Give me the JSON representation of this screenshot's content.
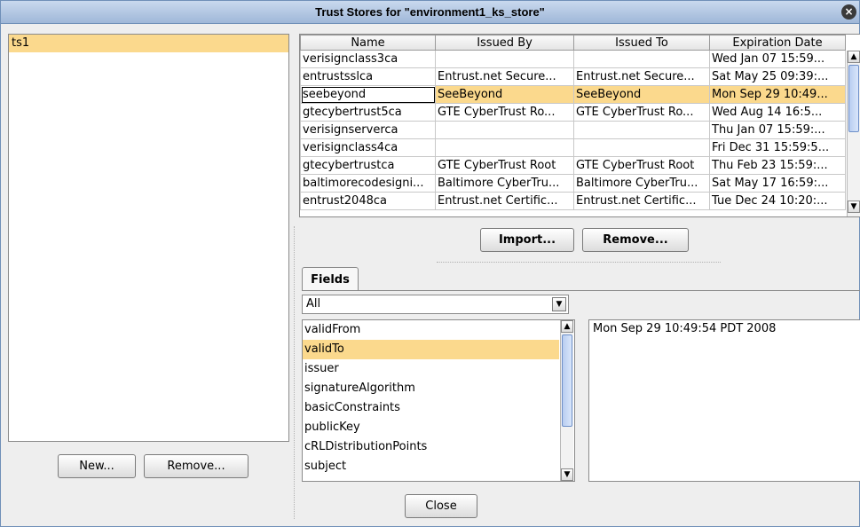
{
  "window": {
    "title": "Trust Stores for \"environment1_ks_store\""
  },
  "icons": {
    "close": "×",
    "up": "▲",
    "down": "▼"
  },
  "stores": {
    "items": [
      "ts1"
    ],
    "new_label": "New...",
    "remove_label": "Remove..."
  },
  "certificates": {
    "columns": [
      "Name",
      "Issued By",
      "Issued To",
      "Expiration Date"
    ],
    "rows": [
      {
        "name": "verisignclass3ca",
        "issued_by": "",
        "issued_to": "",
        "expiration": "Wed Jan 07 15:59..."
      },
      {
        "name": "entrustsslca",
        "issued_by": "Entrust.net Secure...",
        "issued_to": "Entrust.net Secure...",
        "expiration": "Sat May 25 09:39:..."
      },
      {
        "name": "seebeyond",
        "issued_by": "SeeBeyond",
        "issued_to": "SeeBeyond",
        "expiration": "Mon Sep 29 10:49..."
      },
      {
        "name": "gtecybertrust5ca",
        "issued_by": "GTE CyberTrust Ro...",
        "issued_to": "GTE CyberTrust Ro...",
        "expiration": "Wed Aug 14 16:5..."
      },
      {
        "name": "verisignserverca",
        "issued_by": "",
        "issued_to": "",
        "expiration": "Thu Jan 07 15:59:..."
      },
      {
        "name": "verisignclass4ca",
        "issued_by": "",
        "issued_to": "",
        "expiration": "Fri Dec 31 15:59:5..."
      },
      {
        "name": "gtecybertrustca",
        "issued_by": "GTE CyberTrust Root",
        "issued_to": "GTE CyberTrust Root",
        "expiration": "Thu Feb 23 15:59:..."
      },
      {
        "name": "baltimorecodesigni...",
        "issued_by": "Baltimore CyberTru...",
        "issued_to": "Baltimore CyberTru...",
        "expiration": "Sat May 17 16:59:..."
      },
      {
        "name": "entrust2048ca",
        "issued_by": "Entrust.net Certific...",
        "issued_to": "Entrust.net Certific...",
        "expiration": "Tue Dec 24 10:20:..."
      }
    ],
    "import_label": "Import...",
    "remove_label": "Remove..."
  },
  "fields": {
    "tab_label": "Fields",
    "filter_value": "All",
    "items": [
      "validFrom",
      "validTo",
      "issuer",
      "signatureAlgorithm",
      "basicConstraints",
      "publicKey",
      "cRLDistributionPoints",
      "subject"
    ],
    "value": "Mon Sep 29 10:49:54 PDT 2008"
  },
  "footer": {
    "close_label": "Close"
  }
}
